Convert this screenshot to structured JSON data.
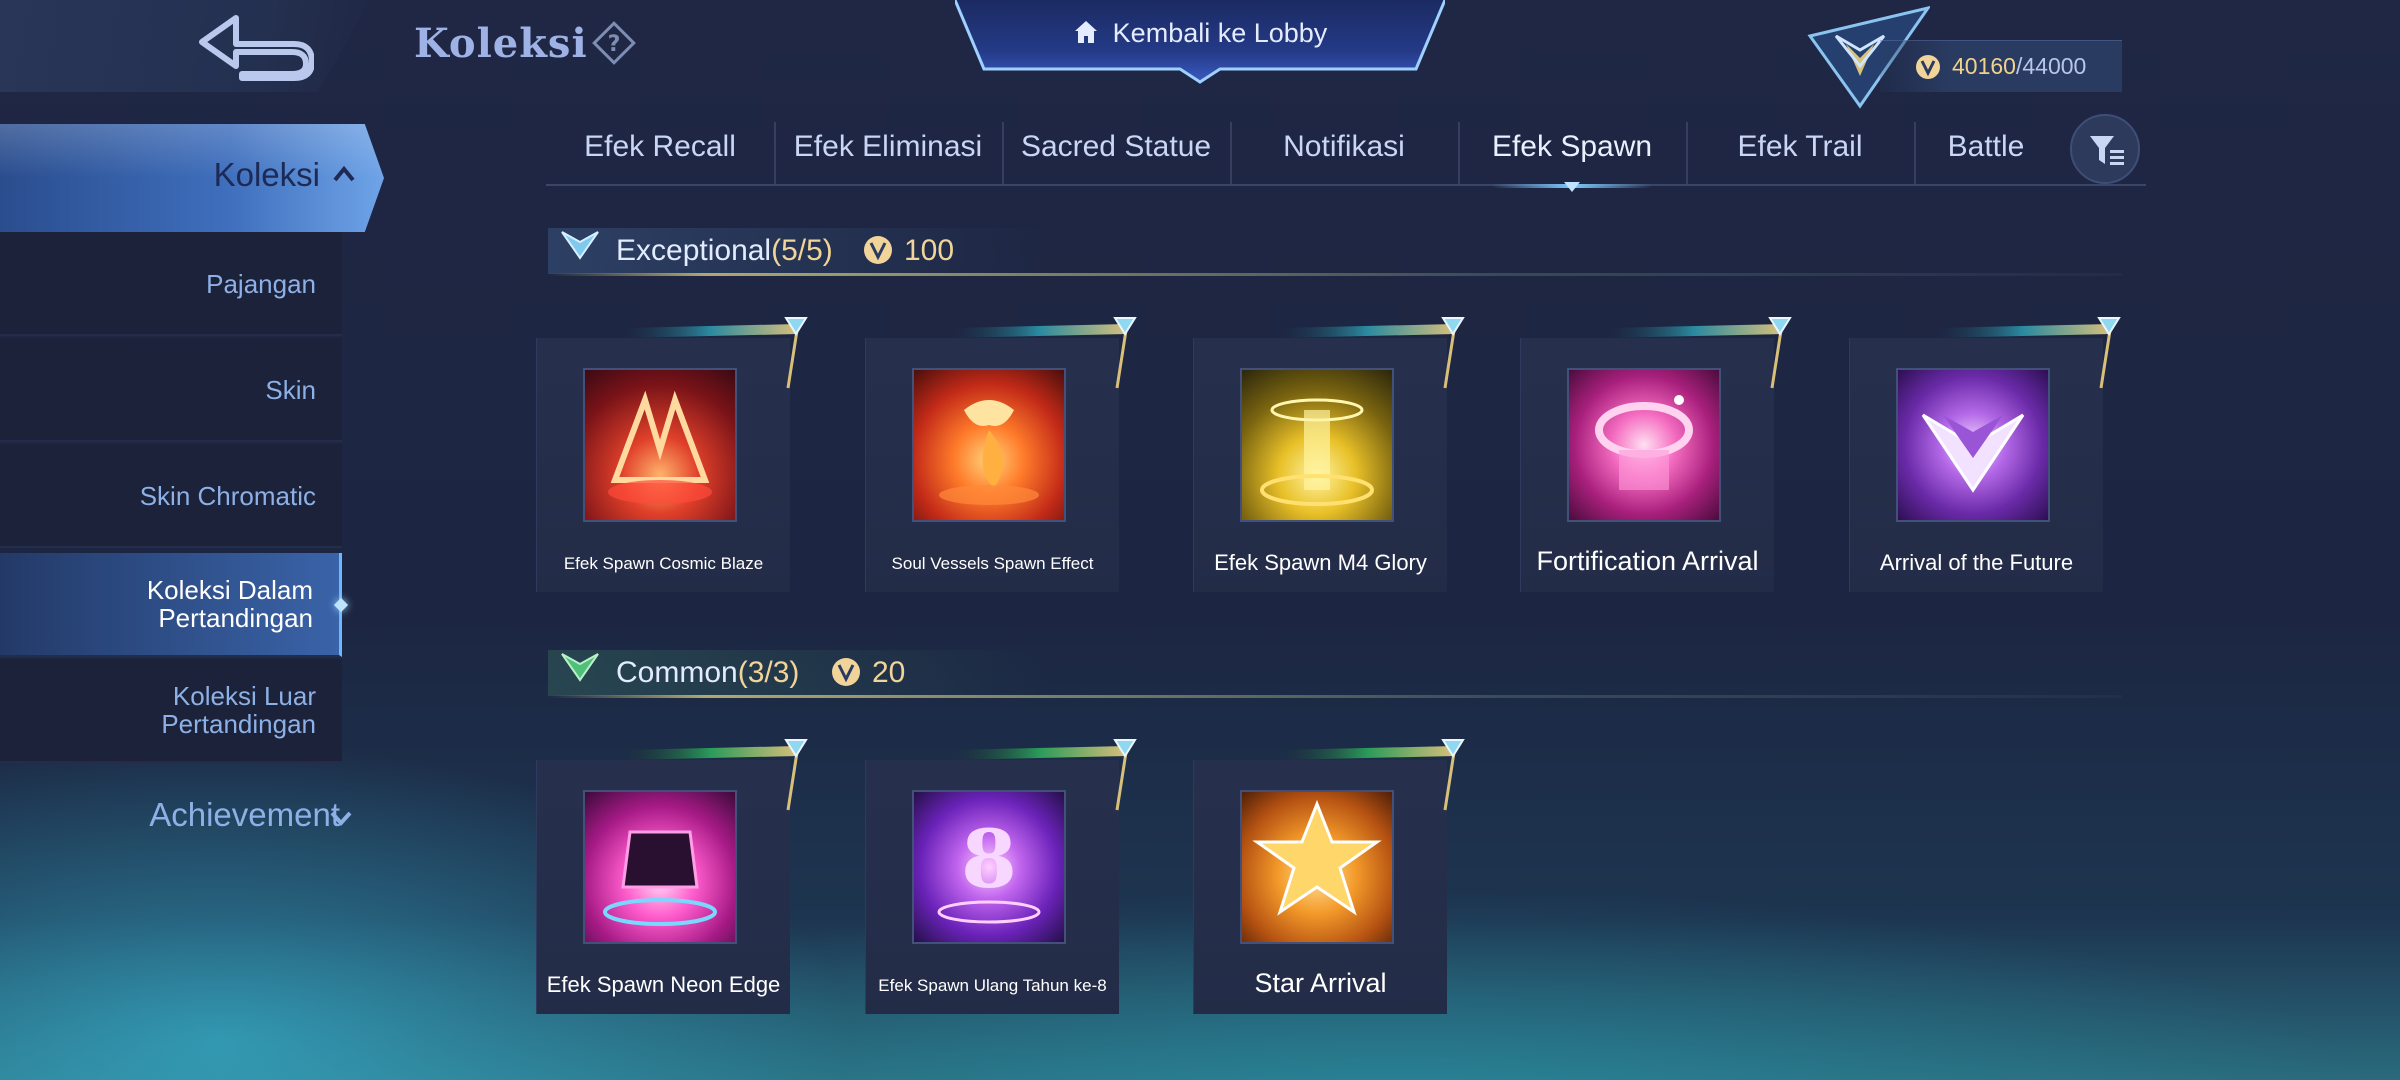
{
  "header": {
    "title": "Koleksi",
    "lobby_button": "Kembali ke Lobby",
    "points_current": "40160",
    "points_max": "/44000"
  },
  "sidebar": {
    "main": "Koleksi",
    "items": [
      {
        "label": "Pajangan"
      },
      {
        "label": "Skin"
      },
      {
        "label": "Skin Chromatic"
      },
      {
        "label": "Koleksi Dalam Pertandingan"
      },
      {
        "label": "Koleksi Luar Pertandingan"
      }
    ],
    "achievement": "Achievement"
  },
  "tabs": [
    {
      "label": "Efek Recall"
    },
    {
      "label": "Efek Eliminasi"
    },
    {
      "label": "Sacred Statue"
    },
    {
      "label": "Notifikasi"
    },
    {
      "label": "Efek Spawn"
    },
    {
      "label": "Efek Trail"
    },
    {
      "label": "Battle"
    }
  ],
  "sections": [
    {
      "title": "Exceptional",
      "count": "(5/5)",
      "cost": "100",
      "items": [
        {
          "name": "Efek Spawn Cosmic Blaze"
        },
        {
          "name": "Soul Vessels Spawn Effect"
        },
        {
          "name": "Efek Spawn M4 Glory"
        },
        {
          "name": "Fortification Arrival"
        },
        {
          "name": "Arrival of the Future"
        }
      ]
    },
    {
      "title": "Common",
      "count": "(3/3)",
      "cost": "20",
      "items": [
        {
          "name": "Efek Spawn Neon Edge"
        },
        {
          "name": "Efek Spawn Ulang Tahun ke-8"
        },
        {
          "name": "Star Arrival"
        }
      ]
    }
  ],
  "colors": {
    "background": "#1f2744",
    "accent_blue": "#6fa4e8",
    "gold": "#f0d49a"
  }
}
